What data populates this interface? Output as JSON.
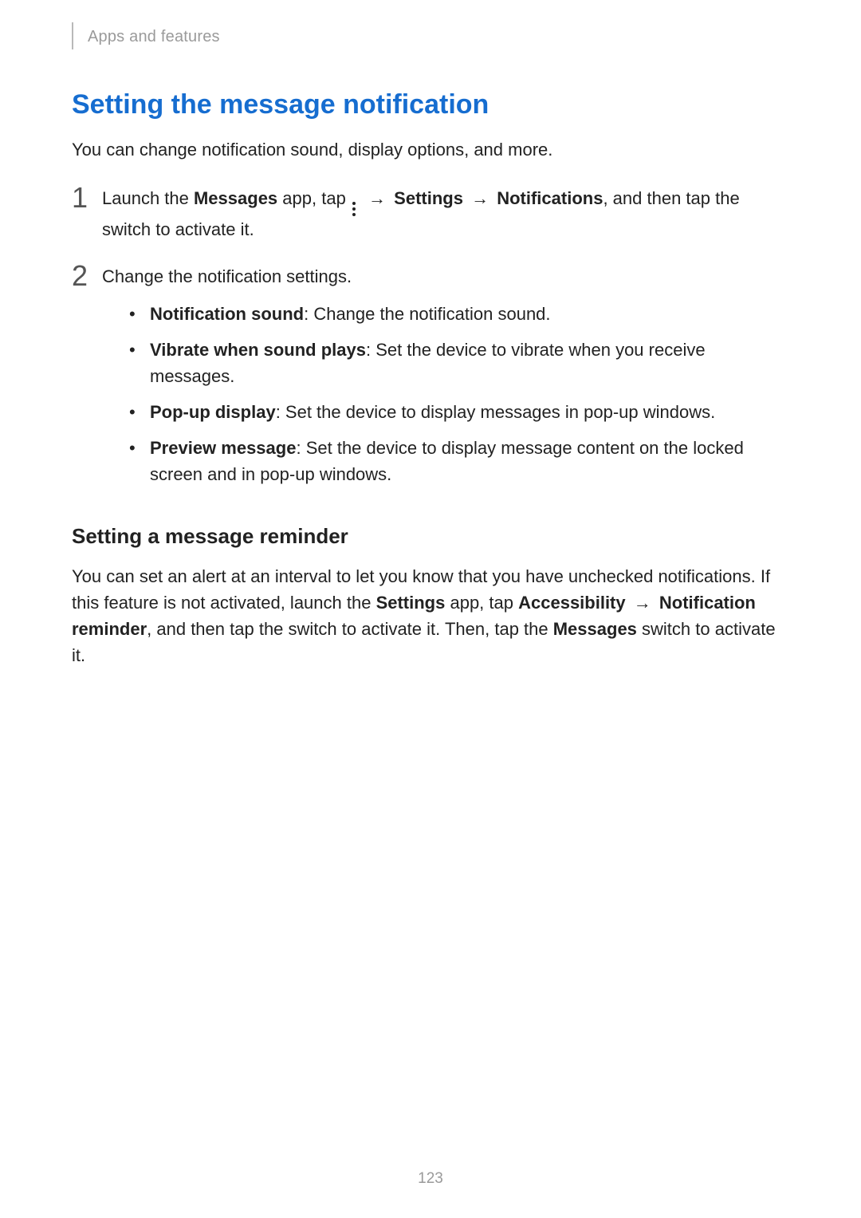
{
  "header": {
    "section": "Apps and features"
  },
  "title": "Setting the message notification",
  "intro": "You can change notification sound, display options, and more.",
  "steps": [
    {
      "num": "1",
      "pre": "Launch the ",
      "app": "Messages",
      "mid": " app, tap ",
      "arrow1": "→",
      "settings": "Settings",
      "arrow2": "→",
      "notifications": "Notifications",
      "post": ", and then tap the switch to activate it."
    },
    {
      "num": "2",
      "text": "Change the notification settings.",
      "bullets": [
        {
          "label": "Notification sound",
          "desc": ": Change the notification sound."
        },
        {
          "label": "Vibrate when sound plays",
          "desc": ": Set the device to vibrate when you receive messages."
        },
        {
          "label": "Pop-up display",
          "desc": ": Set the device to display messages in pop-up windows."
        },
        {
          "label": "Preview message",
          "desc": ": Set the device to display message content on the locked screen and in pop-up windows."
        }
      ]
    }
  ],
  "subheading": "Setting a message reminder",
  "reminder": {
    "s1": "You can set an alert at an interval to let you know that you have unchecked notifications. If this feature is not activated, launch the ",
    "settings_app": "Settings",
    "s2": " app, tap ",
    "accessibility": "Accessibility",
    "arrow": "→",
    "notif_reminder": "Notification reminder",
    "s3": ", and then tap the switch to activate it. Then, tap the ",
    "messages": "Messages",
    "s4": " switch to activate it."
  },
  "page_number": "123"
}
